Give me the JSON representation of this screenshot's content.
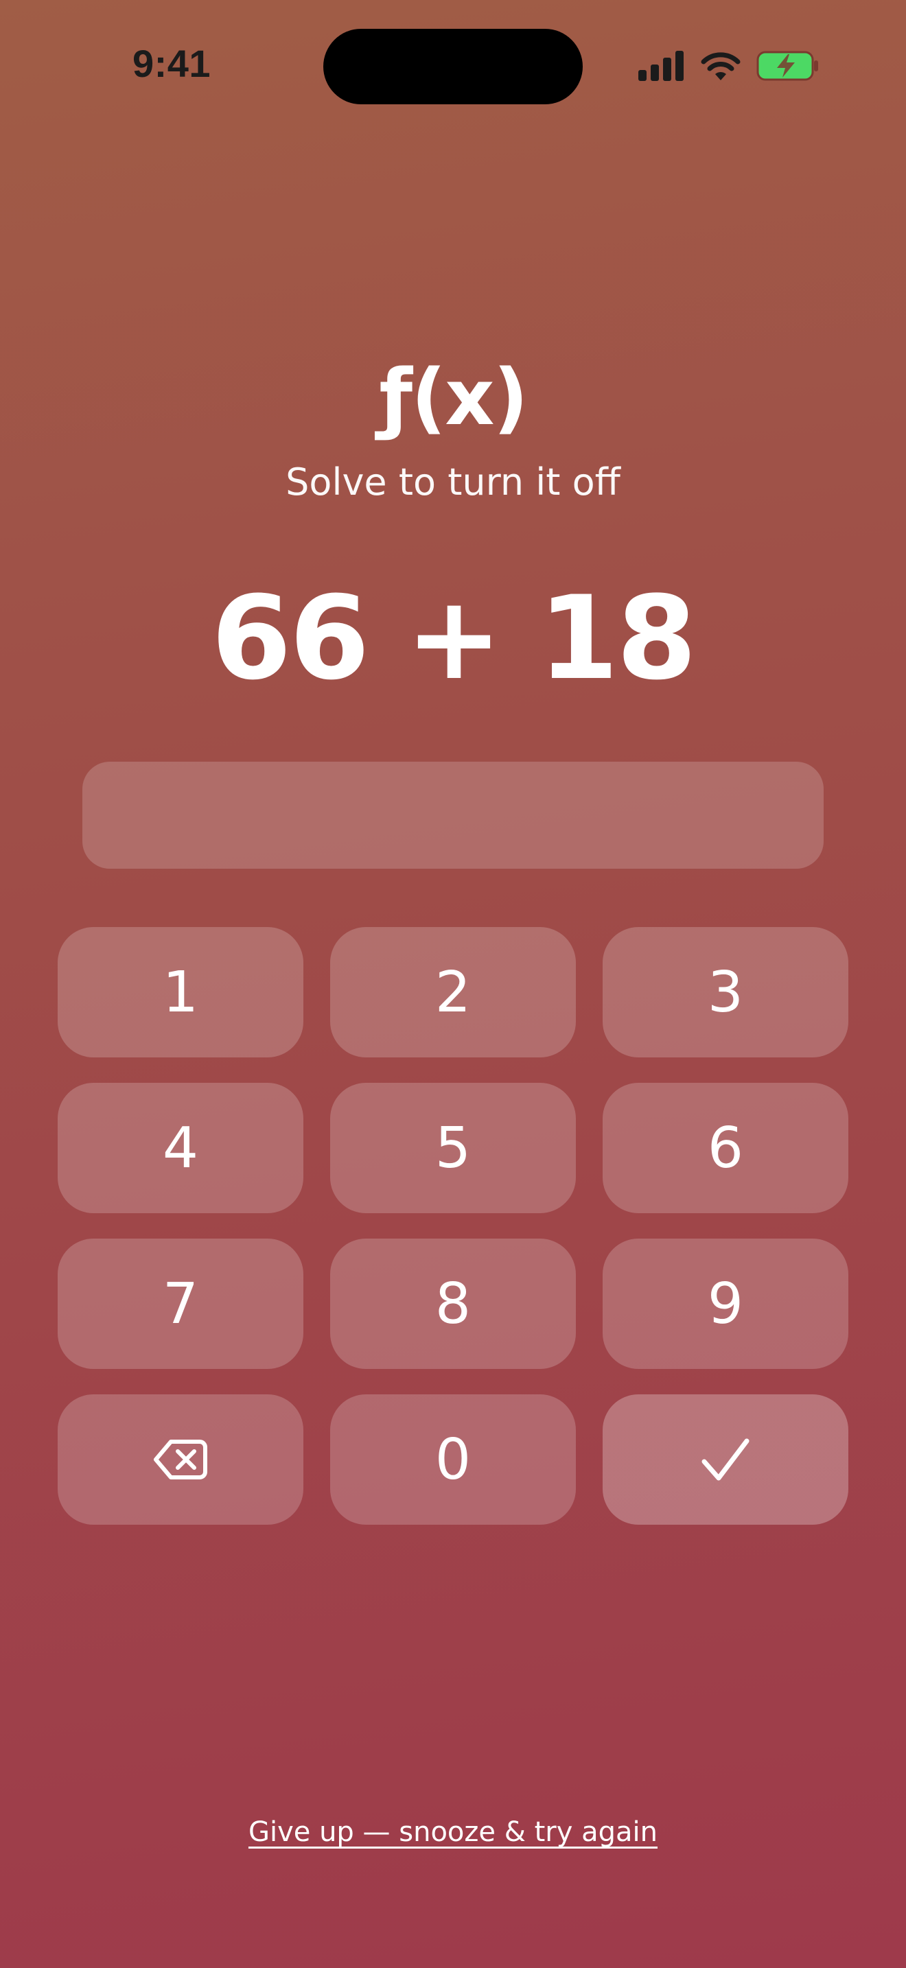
{
  "status_bar": {
    "time": "9:41",
    "icons": [
      "cellular-signal-icon",
      "wifi-icon",
      "battery-charging-icon"
    ],
    "battery_color": "#4cd964"
  },
  "header": {
    "logo": "ƒ(x)",
    "subtitle": "Solve to turn it off"
  },
  "problem": {
    "expression": "66 + 18"
  },
  "answer": {
    "value": ""
  },
  "keypad": {
    "keys": [
      "1",
      "2",
      "3",
      "4",
      "5",
      "6",
      "7",
      "8",
      "9",
      "",
      "0",
      ""
    ],
    "delete_icon": "backspace-icon",
    "submit_icon": "checkmark-icon"
  },
  "footer": {
    "give_up": "Give up — snooze & try again"
  },
  "colors": {
    "gradient_top": "#a05d46",
    "gradient_bottom": "#9e3a4b",
    "text": "#ffffff"
  }
}
